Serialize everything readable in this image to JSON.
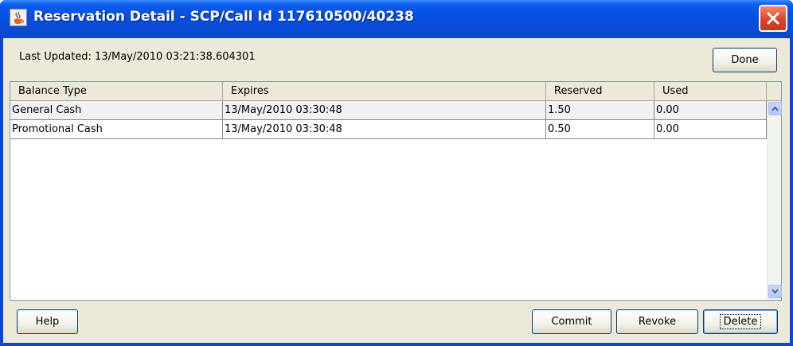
{
  "window": {
    "title": "Reservation Detail - SCP/Call Id 117610500/40238"
  },
  "header": {
    "last_updated": "Last Updated: 13/May/2010 03:21:38.604301",
    "done_label": "Done"
  },
  "table": {
    "columns": [
      "Balance Type",
      "Expires",
      "Reserved",
      "Used"
    ],
    "rows": [
      [
        "General Cash",
        "13/May/2010 03:30:48",
        "1.50",
        "0.00"
      ],
      [
        "Promotional Cash",
        "13/May/2010 03:30:48",
        "0.50",
        "0.00"
      ]
    ]
  },
  "footer": {
    "help_label": "Help",
    "commit_label": "Commit",
    "revoke_label": "Revoke",
    "delete_label": "Delete"
  },
  "icons": {
    "window_icon": "java-cup-icon",
    "close": "close-icon",
    "scroll_up": "scroll-up-arrow-icon",
    "scroll_down": "scroll-down-arrow-icon"
  },
  "colors": {
    "title_bar": "#0a4ad6",
    "close_button": "#d9452a",
    "dialog_background": "#ece9d8"
  }
}
